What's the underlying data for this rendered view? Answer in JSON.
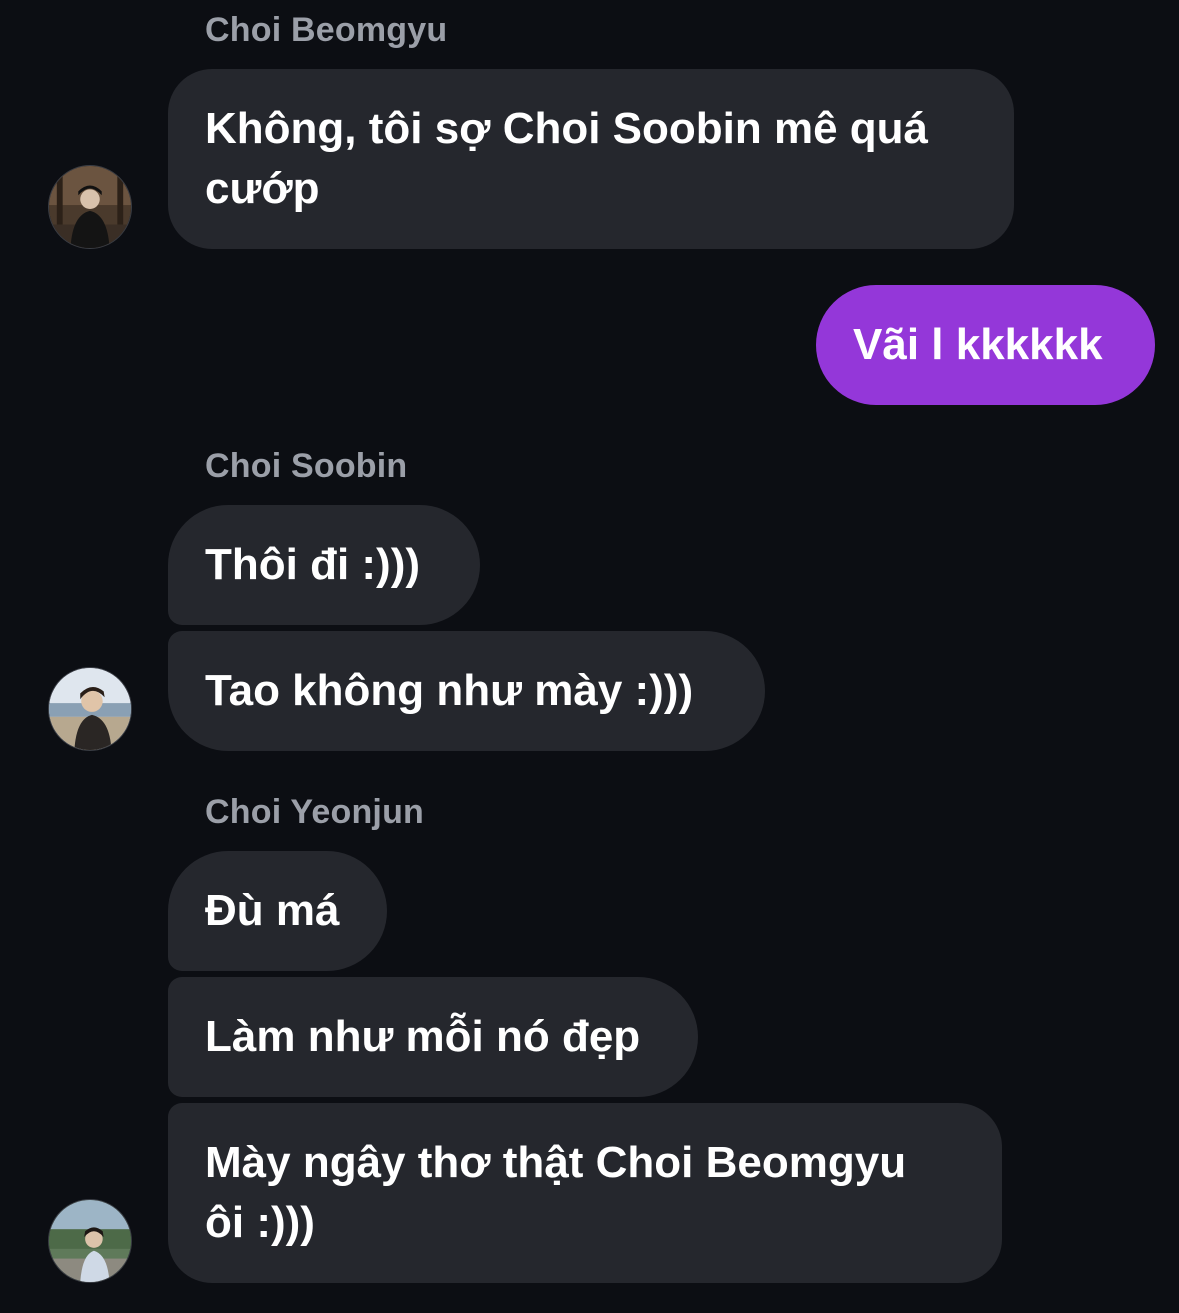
{
  "messages": {
    "beomgyu": {
      "sender": "Choi Beomgyu",
      "text": "Không, tôi sợ Choi Soobin mê quá cướp",
      "line1": "Không, tôi sợ Choi Soobin mê quá",
      "line2": "cướp",
      "avatar_icon": "person-photo-avatar-icon"
    },
    "me": {
      "text": "Vãi l kkkkkk"
    },
    "soobin": {
      "sender": "Choi Soobin",
      "texts": [
        "Thôi đi :)))",
        "Tao không như mày :)))"
      ],
      "avatar_icon": "beach-photo-avatar-icon"
    },
    "yeonjun": {
      "sender": "Choi Yeonjun",
      "texts": [
        "Đù má",
        "Làm như mỗi nó đẹp"
      ],
      "last_line1": "Mày ngây thơ thật Choi Beomgyu",
      "last_line2": "ôi :)))",
      "avatar_icon": "outdoor-photo-avatar-icon"
    }
  },
  "colors": {
    "background": "#0c0e13",
    "incoming_bubble": "#25272d",
    "outgoing_bubble": "#9437d9",
    "sender_name": "#9b9fa8",
    "text": "#ffffff"
  }
}
